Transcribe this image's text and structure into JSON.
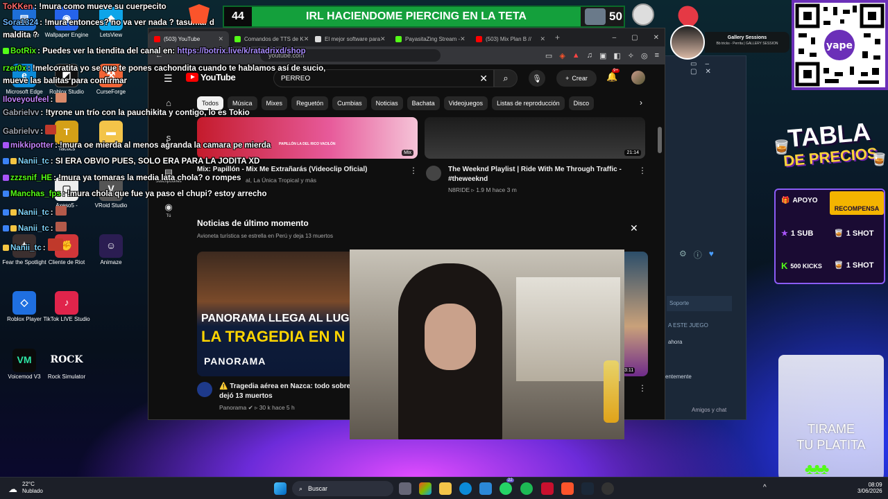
{
  "desktop_icons": [
    {
      "label": "Panelera de",
      "icon": "folder-icon"
    },
    {
      "label": "Wallpaper Engine",
      "icon": "wallpaper-icon"
    },
    {
      "label": "LetsView",
      "icon": "letsview-icon"
    },
    {
      "label": "Microsoft Edge",
      "icon": "edge-icon"
    },
    {
      "label": "Roblox Studio",
      "icon": "roblox-studio-icon"
    },
    {
      "label": "CurseForge",
      "icon": "curseforge-icon"
    },
    {
      "label": "Tactics",
      "icon": "tactics-icon"
    },
    {
      "label": "Axeso5 -",
      "icon": "axeso-icon"
    },
    {
      "label": "VRoid Studio",
      "icon": "vroid-icon"
    },
    {
      "label": "Fear the Spotlight",
      "icon": "game-icon"
    },
    {
      "label": "Cliente de Riot",
      "icon": "riot-icon"
    },
    {
      "label": "Animaze",
      "icon": "animaze-icon"
    },
    {
      "label": "Roblox Player",
      "icon": "roblox-icon"
    },
    {
      "label": "TikTok LIVE Studio",
      "icon": "tiktok-icon"
    },
    {
      "label": "Voicemod V3",
      "icon": "voicemod-icon"
    },
    {
      "label": "Rock Simulator",
      "icon": "rock-icon"
    }
  ],
  "browser": {
    "tabs": [
      {
        "label": "(503) YouTube",
        "color": "#ff0000"
      },
      {
        "label": "Comandos de TTS de K",
        "color": "#53fc18"
      },
      {
        "label": "El mejor software para",
        "color": "#dddddd"
      },
      {
        "label": "PayasitaZing Stream - ",
        "color": "#53fc18"
      },
      {
        "label": "(503) Mix Plan B //",
        "color": "#ff0000"
      }
    ],
    "address": "youtube.com"
  },
  "youtube": {
    "logo": "YouTube",
    "search_value": "PERREO",
    "create_label": "Crear",
    "notif_count": "9+",
    "chips": [
      "Todos",
      "Música",
      "Mixes",
      "Reguetón",
      "Cumbias",
      "Noticias",
      "Bachata",
      "Videojuegos",
      "Listas de reproducción",
      "Disco"
    ],
    "sidebar": [
      {
        "label": "",
        "icon": "home-icon"
      },
      {
        "label": "Shorts",
        "icon": "shorts-icon"
      },
      {
        "label": "Suscripciones",
        "icon": "subscriptions-icon"
      },
      {
        "label": "Tú",
        "icon": "you-icon"
      }
    ],
    "videos": [
      {
        "title": "Mix: Papillón - Mix Me Extrañarás (Videoclip Oficial)",
        "meta": "al, La Única Tropical y más",
        "badge": "Mix",
        "thumb_text": "PAPILLÓN LA DEL RICO VACILÓN"
      },
      {
        "title": "The Weeknd Playlist | Ride With Me Through Traffic - #theweeknd",
        "channel": "N8RIDE",
        "meta": "1.9 M  hace 3 m",
        "duration": "21:14"
      }
    ],
    "news": {
      "heading": "Noticias de último momento",
      "subheading": "Avioneta turística se estrella en Perú y deja 13 muertos",
      "video": {
        "title": "⚠️ Tragedia aérea en Nazca: todo sobre",
        "title2": "dejó 13 muertos",
        "channel": "Panorama",
        "meta": "30 k  hace 5 h",
        "thumb_line1": "PANORAMA LLEGA AL LUGA",
        "thumb_line2": "LA TRAGEDIA EN N",
        "thumb_brand": "PANORAMA"
      },
      "side_duration": "3:11"
    }
  },
  "steam": {
    "support": "Soporte",
    "section": "A ESTE JUEGO",
    "line1": "ahora",
    "line2": "entemente",
    "friends": "Amigos y chat"
  },
  "chat": [
    {
      "user": "ToKKen",
      "text": "!mura como mueve su cuerpecito",
      "color": "#ff6b6b"
    },
    {
      "user": "Sora1324",
      "text": "!mura entonces? no va ver nada ? tasumar d",
      "color": "#6ab7ff"
    },
    {
      "user": "maldita ?",
      "text": "",
      "color": "#ffffff"
    },
    {
      "user": "BotRix",
      "text": "Puedes ver la tiendita del canal en: ",
      "link": "https://botrix.live/k/ratadrixd/shop",
      "color": "#53fc18"
    },
    {
      "user": "rzer0x",
      "text": "!melcoratita yo se que te pones cachondita cuando te hablamos así de sucio,",
      "color": "#53fc18"
    },
    {
      "user": "mueve las balitas para confirmar",
      "text": "",
      "color": "#ffffff"
    },
    {
      "user": "Iloveyoufeel",
      "text": "",
      "color": "#c084fc"
    },
    {
      "user": "Gabrielvv",
      "text": "!tyrone un trío con la pauchikita y contigo, lo es Tokio",
      "color": "#9ca3af"
    },
    {
      "user": "Gabrielvv",
      "text": "",
      "color": "#9ca3af"
    },
    {
      "user": "mikkipotter",
      "text": "!mura oe mierda al menos agranda la camara pe mierda",
      "color": "#c084fc"
    },
    {
      "user": "Nanii_tc",
      "text": "SI ERA OBVIO PUES, SOLO ERA PARA LA JODITA XD",
      "color": "#7dd3fc"
    },
    {
      "user": "zzzsnif_HE",
      "text": "!mura ya tomaras la media lata chola? o rompes",
      "color": "#53fc18"
    },
    {
      "user": "Manchas_fps",
      "text": "!mura chola que fue ya paso el chupi? estoy arrecho",
      "color": "#53fc18"
    },
    {
      "user": "Nanii_tc",
      "text": "",
      "color": "#7dd3fc"
    },
    {
      "user": "Nanii_tc",
      "text": "",
      "color": "#7dd3fc"
    },
    {
      "user": "Nanii_tc",
      "text": "",
      "color": "#7dd3fc"
    }
  ],
  "banner": {
    "left_number": "44",
    "title": "IRL HACIENDOME PIERCING EN LA TETA",
    "right_number": "50"
  },
  "profile": {
    "name": "Gallery Sessions",
    "sub": "Bb tricks - Perrita | GALLERY SESSION"
  },
  "qr": {
    "brand": "yape"
  },
  "prices": {
    "title1": "TABLA",
    "title2": "DE PRECIOS",
    "header_left": "APOYO",
    "header_right": "RECOMPENSA",
    "rows": [
      {
        "left": "1 SUB",
        "right": "1 SHOT"
      },
      {
        "left": "500 KICKS",
        "right": "1 SHOT"
      }
    ]
  },
  "tip_jar": {
    "line1": "TIRAME",
    "line2": "TU PLATITA"
  },
  "taskbar": {
    "temp": "22°C",
    "weather": "Nublado",
    "search": "Buscar",
    "whatsapp_badge": "22",
    "time": "08:09",
    "date": "3/06/2026"
  }
}
